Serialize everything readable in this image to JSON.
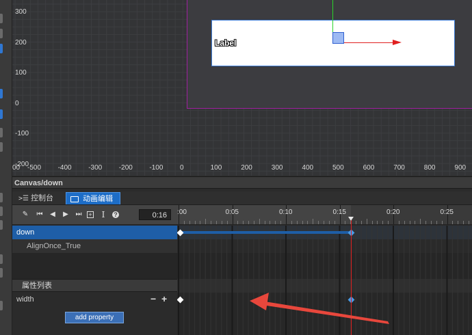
{
  "scene": {
    "y_labels": [
      "300",
      "200",
      "100",
      "0",
      "-100",
      "-200"
    ],
    "x_labels": [
      "00",
      "-500",
      "-400",
      "-300",
      "-200",
      "-100",
      "0",
      "100",
      "200",
      "300",
      "400",
      "500",
      "600",
      "700",
      "800",
      "900"
    ],
    "label_node_text": "Label"
  },
  "path_bar": {
    "text": "Canvas/down"
  },
  "tabs": [
    {
      "icon": "console-icon",
      "label": "控制台"
    },
    {
      "icon": "monitor-icon",
      "label": "动画编辑器",
      "active": true
    }
  ],
  "toolbar": {
    "icons": [
      "edit-icon",
      "jump-first-icon",
      "step-back-icon",
      "play-icon",
      "step-forward-icon",
      "add-keyframe-icon",
      "text-cursor-icon",
      "help-icon"
    ],
    "current_time": "0:16"
  },
  "timeline": {
    "ticks": [
      ":00",
      "0:05",
      "0:10",
      "0:15",
      "0:20",
      "0:25"
    ]
  },
  "tracks": {
    "node_name": "down",
    "clip_name": "AlignOnce_True"
  },
  "properties": {
    "header": "属性列表",
    "items": [
      {
        "name": "width",
        "minus": "−",
        "plus": "+"
      }
    ],
    "add_button": "add property"
  },
  "colors": {
    "accent_blue": "#1d6dc7",
    "selected_row": "#1e5ea7",
    "playhead": "#e02020",
    "keyframe": "#4a9be8",
    "design_border": "#a020a0"
  }
}
